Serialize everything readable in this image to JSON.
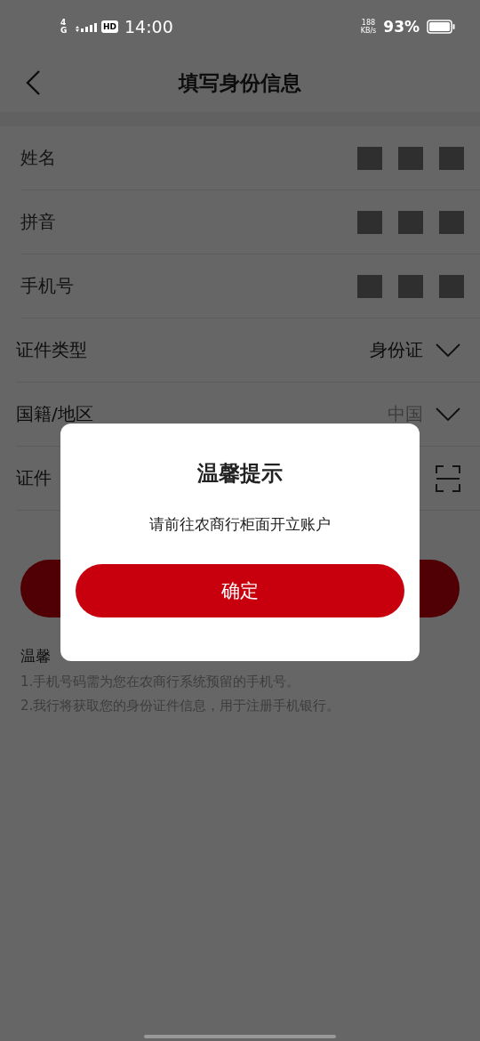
{
  "status_bar": {
    "network": "4G",
    "hd": "HD",
    "time": "14:00",
    "speed_value": "188",
    "speed_unit": "KB/s",
    "battery": "93%"
  },
  "header": {
    "title": "填写身份信息"
  },
  "form": {
    "rows": [
      {
        "kind": "text",
        "label": "姓名"
      },
      {
        "kind": "text",
        "label": "拼音"
      },
      {
        "kind": "text",
        "label": "手机号"
      },
      {
        "kind": "select",
        "label": "证件类型",
        "value": "身份证",
        "disabled": false
      },
      {
        "kind": "select",
        "label": "国籍/地区",
        "value": "中国",
        "disabled": true
      },
      {
        "kind": "scan",
        "label": "证件"
      }
    ]
  },
  "tips": {
    "title": "温馨"
  },
  "tip_lines": [
    "1.手机号码需为您在农商行系统预留的手机号。",
    "2.我行将获取您的身份证件信息，用于注册手机银行。"
  ],
  "dialog": {
    "title": "温馨提示",
    "message": "请前往农商行柜面开立账户",
    "button": "确定"
  }
}
